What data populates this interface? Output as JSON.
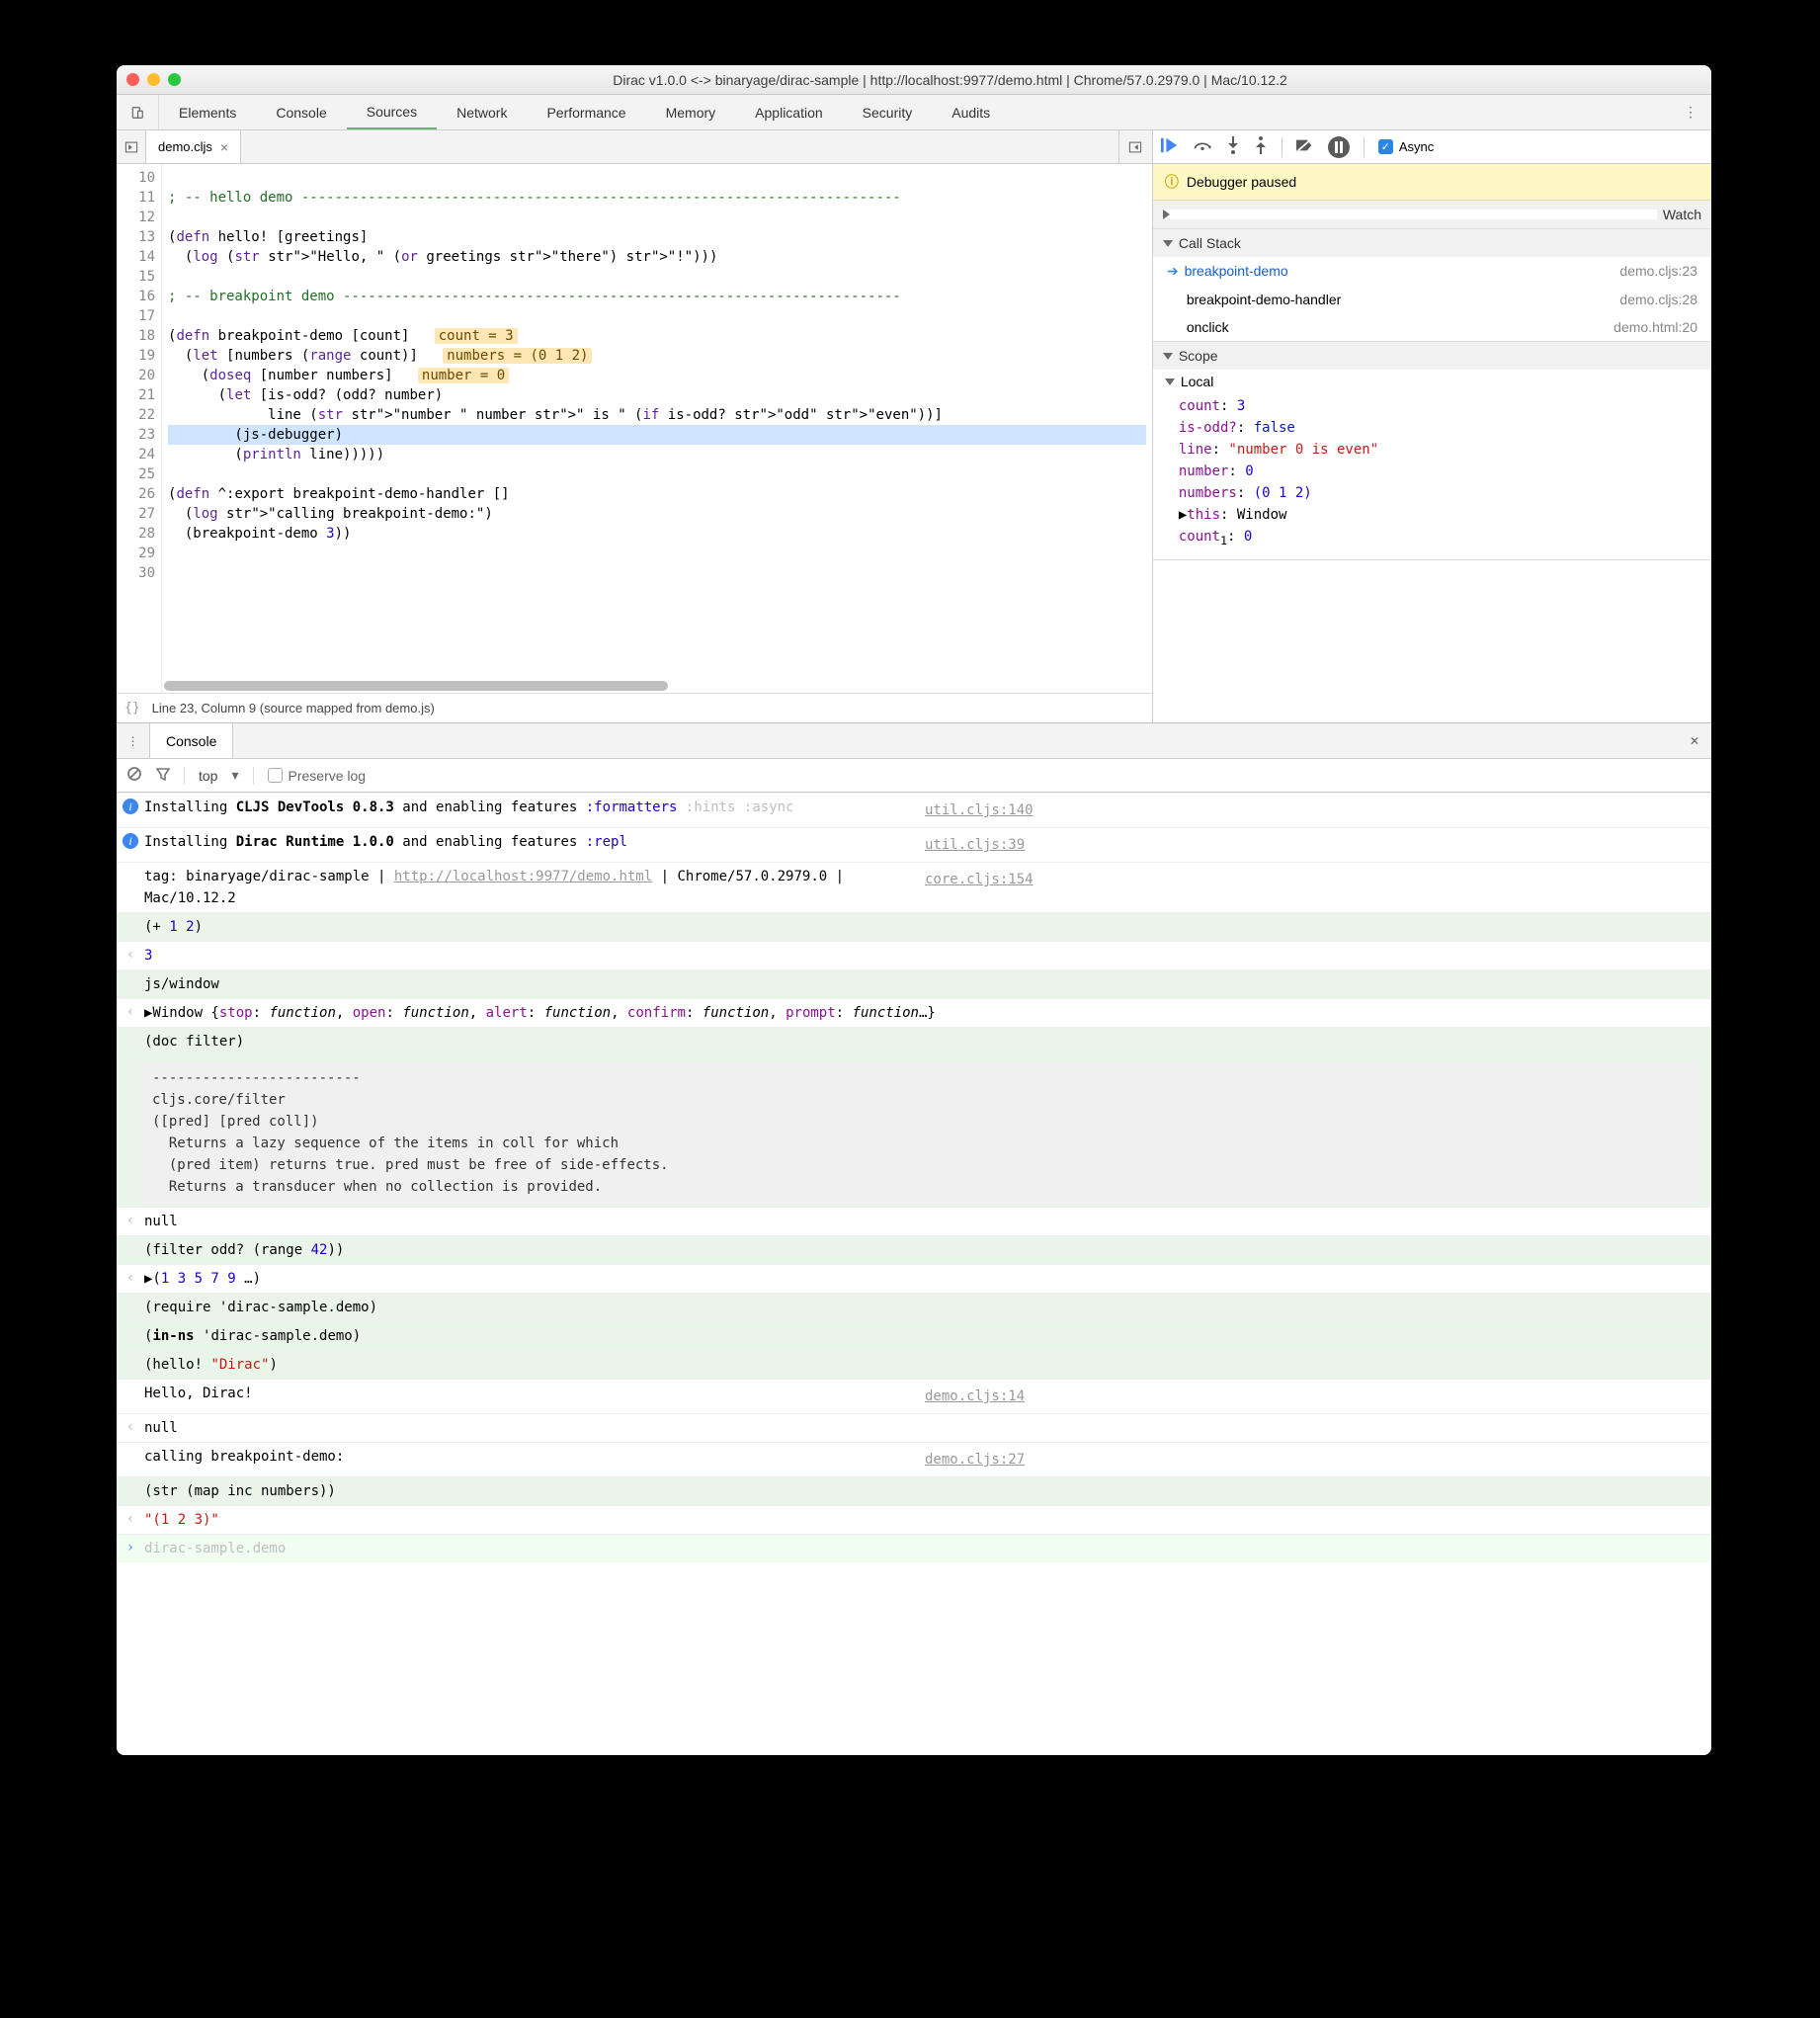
{
  "titlebar": {
    "title": "Dirac v1.0.0 <-> binaryage/dirac-sample | http://localhost:9977/demo.html | Chrome/57.0.2979.0 | Mac/10.12.2"
  },
  "tabs": {
    "elements": "Elements",
    "console": "Console",
    "sources": "Sources",
    "network": "Network",
    "performance": "Performance",
    "memory": "Memory",
    "application": "Application",
    "security": "Security",
    "audits": "Audits"
  },
  "filetab": {
    "name": "demo.cljs"
  },
  "code": {
    "lines": [
      "",
      "; -- hello demo ------------------------------------------------------------------------",
      "",
      "(defn hello! [greetings]",
      "  (log (str \"Hello, \" (or greetings \"there\") \"!\")))",
      "",
      "; -- breakpoint demo -------------------------------------------------------------------",
      "",
      "(defn breakpoint-demo [count]",
      "  (let [numbers (range count)]",
      "    (doseq [number numbers]",
      "      (let [is-odd? (odd? number)",
      "            line (str \"number \" number \" is \" (if is-odd? \"odd\" \"even\"))]",
      "        (js-debugger)",
      "        (println line)))))",
      "",
      "(defn ^:export breakpoint-demo-handler []",
      "  (log \"calling breakpoint-demo:\")",
      "  (breakpoint-demo 3))",
      "",
      ""
    ],
    "first_lineno": 10,
    "highlight_index": 13,
    "annotations": {
      "8": "count = 3",
      "9": "numbers = (0 1 2)",
      "10": "number = 0"
    }
  },
  "status": {
    "text": "Line 23, Column 9   (source mapped from demo.js)"
  },
  "async_label": "Async",
  "banner": "Debugger paused",
  "sections": {
    "watch": "Watch",
    "callstack": "Call Stack",
    "scope": "Scope"
  },
  "callstack": [
    {
      "name": "breakpoint-demo",
      "loc": "demo.cljs:23",
      "current": true
    },
    {
      "name": "breakpoint-demo-handler",
      "loc": "demo.cljs:28"
    },
    {
      "name": "onclick",
      "loc": "demo.html:20"
    }
  ],
  "scope_local_label": "Local",
  "scope_local": [
    {
      "k": "count",
      "v": "3",
      "t": "num"
    },
    {
      "k": "is-odd?",
      "v": "false",
      "t": "bool"
    },
    {
      "k": "line",
      "v": "\"number 0 is even\"",
      "t": "str"
    },
    {
      "k": "number",
      "v": "0",
      "t": "num"
    },
    {
      "k": "numbers",
      "v": "(0 1 2)",
      "t": "seq"
    }
  ],
  "scope_this": {
    "label": "this",
    "val": "Window"
  },
  "scope_extra": {
    "k": "count",
    "sub": "1",
    "v": "0"
  },
  "drawer_tab": "Console",
  "console_toolbar": {
    "context": "top",
    "preserve": "Preserve log"
  },
  "console_lines": [
    {
      "kind": "info",
      "body_html": "Installing <b>CLJS DevTools 0.8.3</b> and enabling features <span class='func'>:formatters</span> <span class='dim'>:hints :async</span>",
      "src": "util.cljs:140"
    },
    {
      "kind": "info",
      "body_html": "Installing <b>Dirac Runtime 1.0.0</b> and enabling features <span class='func'>:repl</span>",
      "src": "util.cljs:39"
    },
    {
      "kind": "plain",
      "body_html": "tag: binaryage/dirac-sample | <span class='link'>http://localhost:9977/demo.html</span> | Chrome/57.0.2979.0 | Mac/10.12.2",
      "src": "core.cljs:154"
    },
    {
      "kind": "in",
      "body_html": "(+ <span class='func'>1 2</span>)"
    },
    {
      "kind": "out",
      "body_html": "<span class='func'>3</span>"
    },
    {
      "kind": "in",
      "body_html": "js/window"
    },
    {
      "kind": "out",
      "body_html": "▶Window {<span class='k-name'>stop</span>: <span style='font-style:italic'>function</span>, <span class='k-name'>open</span>: <span style='font-style:italic'>function</span>, <span class='k-name'>alert</span>: <span style='font-style:italic'>function</span>, <span class='k-name'>confirm</span>: <span style='font-style:italic'>function</span>, <span class='k-name'>prompt</span>: <span style='font-style:italic'>function</span>…}"
    },
    {
      "kind": "in",
      "body_html": "(doc filter)"
    },
    {
      "kind": "docblock",
      "body_html": "-------------------------\ncljs.core/filter\n([pred] [pred coll])\n  Returns a lazy sequence of the items in coll for which\n  (pred item) returns true. pred must be free of side-effects.\n  Returns a transducer when no collection is provided."
    },
    {
      "kind": "out",
      "body_html": "null"
    },
    {
      "kind": "in",
      "body_html": "(filter odd? (range <span class='func'>42</span>))"
    },
    {
      "kind": "out",
      "body_html": "▶(<span class='func'>1 3 5 7 9</span> …)"
    },
    {
      "kind": "in",
      "body_html": "(require 'dirac-sample.demo)"
    },
    {
      "kind": "in",
      "body_html": "(<b>in-ns</b> 'dirac-sample.demo)"
    },
    {
      "kind": "in",
      "body_html": "(hello! <span class='k-str'>\"Dirac\"</span>)"
    },
    {
      "kind": "plain",
      "body_html": "Hello, Dirac!",
      "src": "demo.cljs:14"
    },
    {
      "kind": "out",
      "body_html": "null"
    },
    {
      "kind": "plain",
      "body_html": "calling breakpoint-demo:",
      "src": "demo.cljs:27"
    },
    {
      "kind": "in",
      "body_html": "(str (map inc numbers))"
    },
    {
      "kind": "out",
      "body_html": "<span class='k-str'>\"(1 2 3)\"</span>"
    },
    {
      "kind": "prompt",
      "body_html": "<span class='dim'>dirac-sample.demo</span>"
    }
  ]
}
